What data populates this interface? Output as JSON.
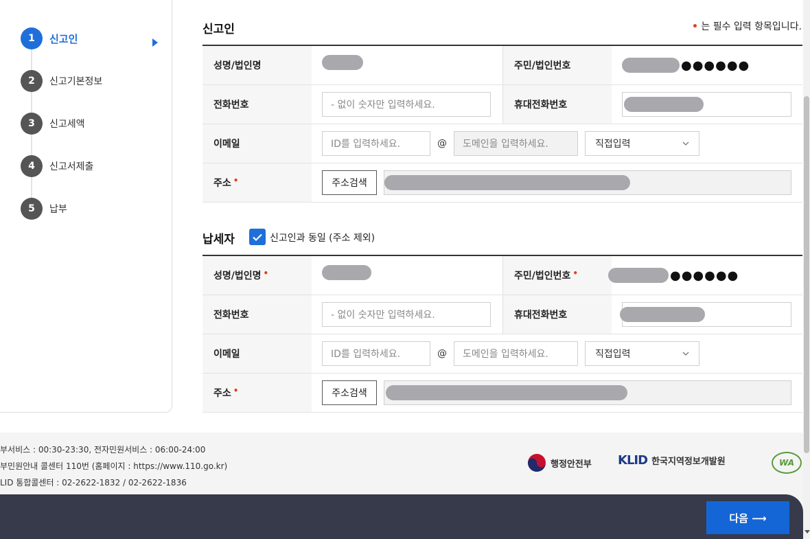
{
  "steps": [
    {
      "num": "1",
      "label": "신고인"
    },
    {
      "num": "2",
      "label": "신고기본정보"
    },
    {
      "num": "3",
      "label": "신고세액"
    },
    {
      "num": "4",
      "label": "신고서제출"
    },
    {
      "num": "5",
      "label": "납부"
    }
  ],
  "reporter": {
    "title": "신고인",
    "required_note": "는 필수 입력 항목입니다.",
    "required_mark": "•",
    "name_label": "성명/법인명",
    "id_label": "주민/법인번호",
    "id_masked": "●●●●●●",
    "phone_label": "전화번호",
    "phone_placeholder": "- 없이 숫자만 입력하세요.",
    "mobile_label": "휴대전화번호",
    "email_label": "이메일",
    "email_id_placeholder": "ID를 입력하세요.",
    "at": "@",
    "email_domain_placeholder": "도메인을 입력하세요.",
    "domain_select": "직접입력",
    "address_label": "주소",
    "address_button": "주소검색"
  },
  "taxpayer": {
    "title": "납세자",
    "same_as_reporter": "신고인과 동일 (주소 제외)",
    "name_label": "성명/법인명",
    "id_label": "주민/법인번호",
    "id_masked": "●●●●●●",
    "phone_label": "전화번호",
    "phone_placeholder": "- 없이 숫자만 입력하세요.",
    "mobile_label": "휴대전화번호",
    "email_label": "이메일",
    "email_id_placeholder": "ID를 입력하세요.",
    "at": "@",
    "email_domain_placeholder": "도메인을 입력하세요.",
    "domain_select": "직접입력",
    "address_label": "주소",
    "address_button": "주소검색"
  },
  "footer": {
    "line1": "부서비스 : 00:30-23:30, 전자민원서비스 : 06:00-24:00",
    "line2": "부민원안내 콜센터 110번 (홈페이지 : https://www.110.go.kr)",
    "line3": "LID 통합콜센터 : 02-2622-1832 / 02-2622-1836",
    "logo_mois": "행정안전부",
    "logo_klid_mark": "KLID",
    "logo_klid": "한국지역정보개발원",
    "logo_wa": "WA"
  },
  "next_button": "다음 ⟶",
  "colors": {
    "accent": "#1e6fd9",
    "required": "#e0401c",
    "bottom_bar": "#363a4a"
  }
}
